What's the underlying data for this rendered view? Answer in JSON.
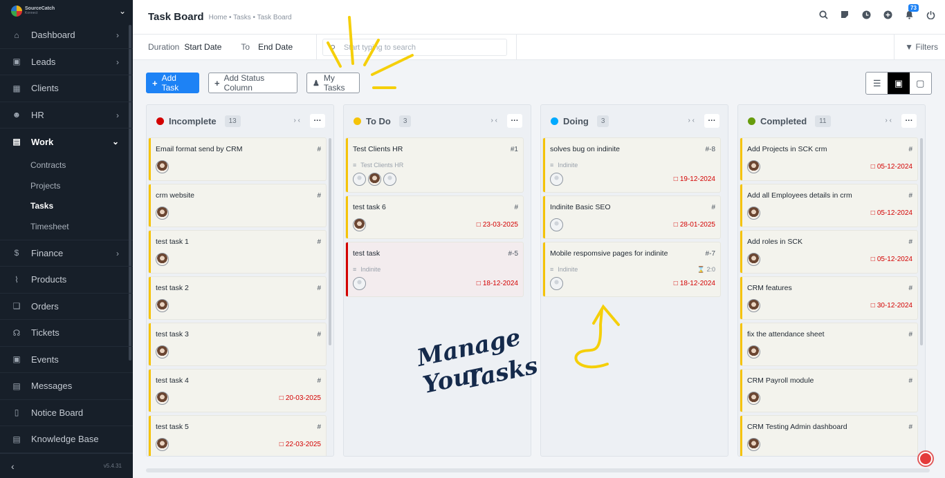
{
  "sidebar": {
    "logo_line1": "SourceCatch",
    "logo_line2": "Konnect",
    "items": [
      {
        "label": "Dashboard"
      },
      {
        "label": "Leads"
      },
      {
        "label": "Clients"
      },
      {
        "label": "HR"
      },
      {
        "label": "Work"
      },
      {
        "label": "Finance"
      },
      {
        "label": "Products"
      },
      {
        "label": "Orders"
      },
      {
        "label": "Tickets"
      },
      {
        "label": "Events"
      },
      {
        "label": "Messages"
      },
      {
        "label": "Notice Board"
      },
      {
        "label": "Knowledge Base"
      }
    ],
    "work_sub": [
      {
        "label": "Contracts"
      },
      {
        "label": "Projects"
      },
      {
        "label": "Tasks"
      },
      {
        "label": "Timesheet"
      }
    ],
    "version": "v5.4.31"
  },
  "header": {
    "title": "Task Board",
    "breadcrumb": "Home • Tasks • Task Board",
    "notification_count": "73"
  },
  "filterbar": {
    "duration_label": "Duration",
    "start": "Start Date",
    "to_label": "To",
    "end": "End Date",
    "search_placeholder": "Start typing to search",
    "filters_label": "Filters"
  },
  "actions": {
    "add_task": "Add Task",
    "add_status": "Add Status Column",
    "my_tasks": "My Tasks"
  },
  "columns": [
    {
      "name": "Incomplete",
      "count": "13",
      "color": "#d30000",
      "cards": [
        {
          "title": "Email format send by CRM",
          "id": "#"
        },
        {
          "title": "crm website",
          "id": "#"
        },
        {
          "title": "test task 1",
          "id": "#"
        },
        {
          "title": "test task 2",
          "id": "#"
        },
        {
          "title": "test task 3",
          "id": "#"
        },
        {
          "title": "test task 4",
          "id": "#",
          "date": "20-03-2025"
        },
        {
          "title": "test task 5",
          "id": "#",
          "date": "22-03-2025"
        }
      ]
    },
    {
      "name": "To Do",
      "count": "3",
      "color": "#f5c308",
      "cards": [
        {
          "title": "Test Clients HR",
          "id": "#1",
          "project": "Test Clients HR"
        },
        {
          "title": "test task 6",
          "id": "#",
          "date": "23-03-2025"
        },
        {
          "title": "test task",
          "id": "#-5",
          "project": "Indinite",
          "date": "18-12-2024"
        }
      ]
    },
    {
      "name": "Doing",
      "count": "3",
      "color": "#00aaff",
      "cards": [
        {
          "title": "solves bug on indinite",
          "id": "#-8",
          "project": "Indinite",
          "date": "19-12-2024"
        },
        {
          "title": "Indinite Basic SEO",
          "id": "#",
          "date": "28-01-2025"
        },
        {
          "title": "Mobile respomsive pages for indinite",
          "id": "#-7",
          "project": "Indinite",
          "timer": "2:0",
          "date": "18-12-2024"
        }
      ]
    },
    {
      "name": "Completed",
      "count": "11",
      "color": "#679c0d",
      "cards": [
        {
          "title": "Add Projects in SCK crm",
          "id": "#",
          "date": "05-12-2024"
        },
        {
          "title": "Add all Employees details in crm",
          "id": "#",
          "date": "05-12-2024"
        },
        {
          "title": "Add roles in SCK",
          "id": "#",
          "date": "05-12-2024"
        },
        {
          "title": "CRM features",
          "id": "#",
          "date": "30-12-2024"
        },
        {
          "title": "fix the attendance sheet",
          "id": "#"
        },
        {
          "title": "CRM Payroll module",
          "id": "#"
        },
        {
          "title": "CRM Testing Admin dashboard",
          "id": "#"
        }
      ]
    }
  ],
  "annotation": {
    "line1": "Manage Your",
    "line2": "Tasks"
  }
}
